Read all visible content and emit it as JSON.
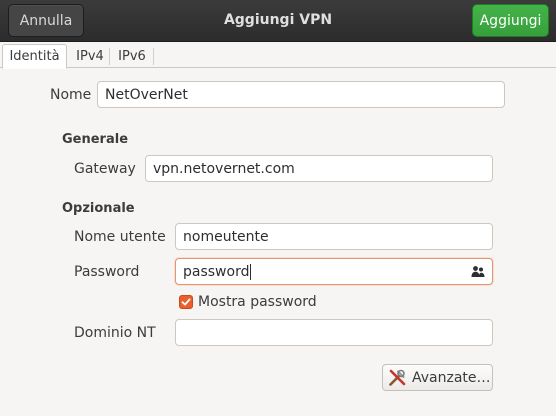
{
  "header": {
    "title": "Aggiungi VPN",
    "cancel_label": "Annulla",
    "add_label": "Aggiungi",
    "accent_color": "#3daa42"
  },
  "tabs": [
    {
      "label": "Identità",
      "active": true
    },
    {
      "label": "IPv4",
      "active": false
    },
    {
      "label": "IPv6",
      "active": false
    }
  ],
  "form": {
    "name_label": "Nome",
    "name_value": "NetOverNet",
    "general_heading": "Generale",
    "gateway_label": "Gateway",
    "gateway_value": "vpn.netovernet.com",
    "optional_heading": "Opzionale",
    "username_label": "Nome utente",
    "username_value": "nomeutente",
    "password_label": "Password",
    "password_value": "password",
    "password_icon": "users-icon",
    "show_password_label": "Mostra password",
    "show_password_checked": true,
    "nt_domain_label": "Dominio NT",
    "nt_domain_value": "",
    "advanced_label": "Avanzate…",
    "advanced_icon": "tools-icon"
  }
}
